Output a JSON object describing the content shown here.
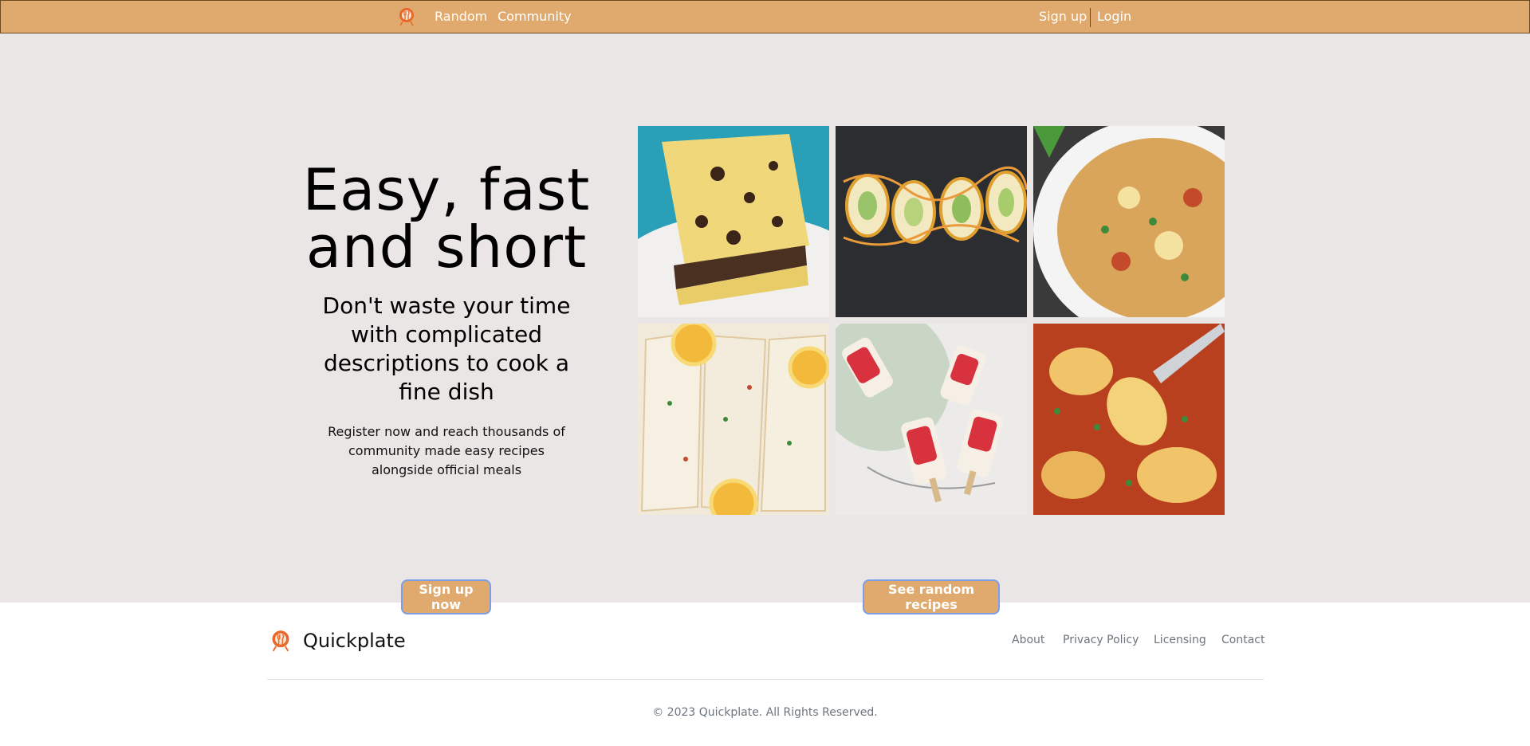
{
  "nav": {
    "logo_icon": "quickplate-logo-icon",
    "random": "Random",
    "community": "Community",
    "signup": "Sign up",
    "login": "Login"
  },
  "hero": {
    "headline": "Easy, fast and short",
    "subheadline": "Don't waste your time with complicated descriptions to cook a fine dish",
    "description": "Register now and reach thousands of community made easy recipes alongside official meals",
    "signup_button": "Sign up now",
    "random_button": "See random recipes",
    "images": [
      "chocolate-chip-bars-photo",
      "sushi-rolls-photo",
      "pasta-casserole-photo",
      "lemon-fish-fillets-photo",
      "berry-popsicles-photo",
      "baked-pasta-shells-photo"
    ]
  },
  "footer": {
    "brand": "Quickplate",
    "links": [
      "About",
      "Privacy Policy",
      "Licensing",
      "Contact"
    ],
    "copyright": "© 2023 Quickplate. All Rights Reserved."
  },
  "colors": {
    "nav_bg": "#e0a96d",
    "hero_bg": "#eae6e5",
    "button_border": "#7d9ee6",
    "logo_accent": "#e8682a"
  }
}
